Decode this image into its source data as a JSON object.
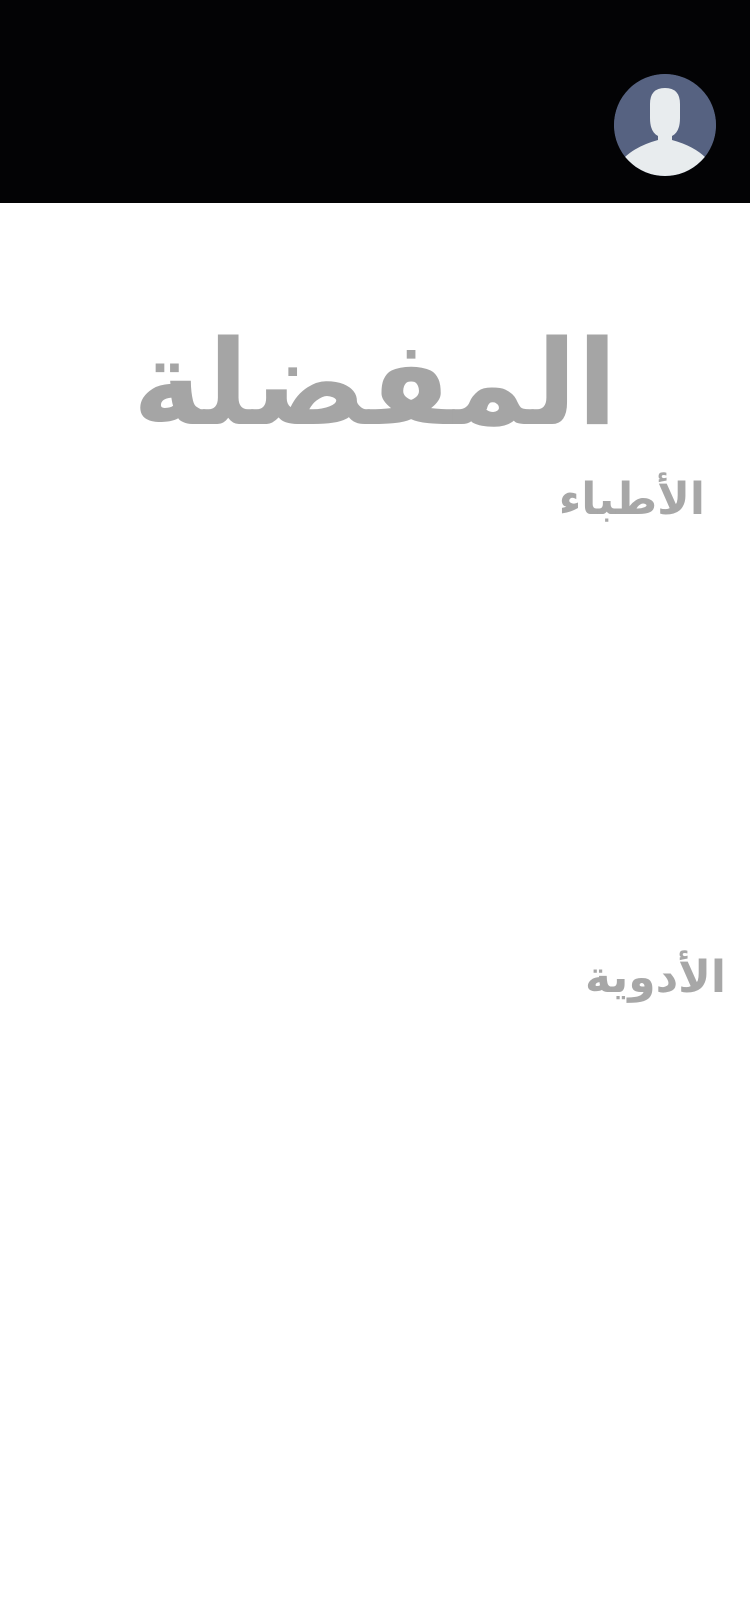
{
  "header": {
    "background_color": "#030305",
    "avatar": {
      "icon": "user-silhouette-icon",
      "background_color": "#566281",
      "figure_color": "#e8ecee"
    }
  },
  "main": {
    "title": "المفضلة",
    "title_color": "#a5a5a5",
    "sections": [
      {
        "heading": "الأطباء",
        "items": []
      },
      {
        "heading": "الأدوية",
        "items": []
      }
    ]
  }
}
